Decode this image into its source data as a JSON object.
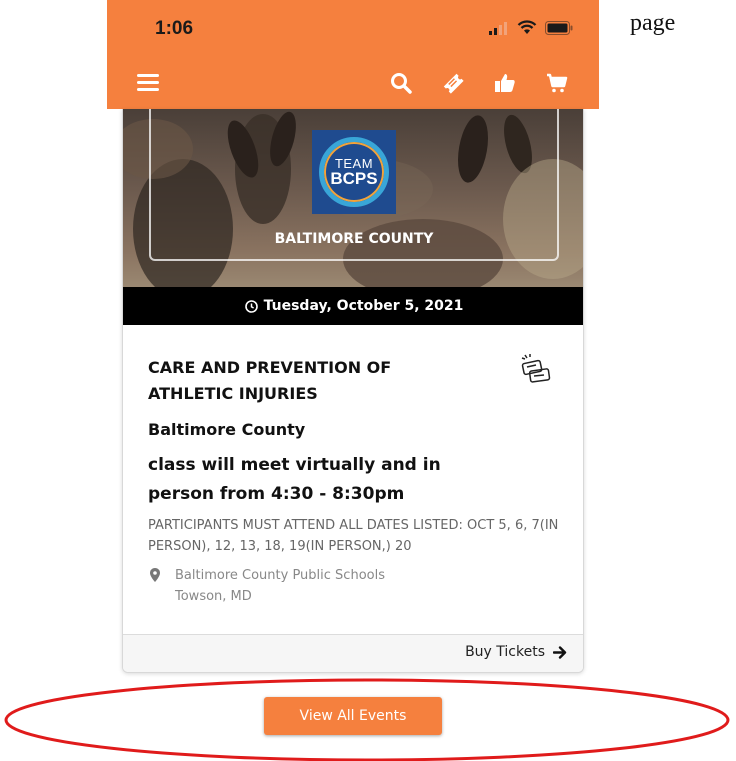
{
  "page_fragment": "page",
  "status_bar": {
    "time": "1:06"
  },
  "header": {
    "icons": [
      "menu-icon",
      "search-icon",
      "ticket-icon",
      "thumbs-up-icon",
      "cart-icon"
    ],
    "accent_color": "#f5803e"
  },
  "event": {
    "logo_line1": "TEAM",
    "logo_line2": "BCPS",
    "hero_title": "BALTIMORE COUNTY",
    "date": "Tuesday, October 5, 2021",
    "title": "CARE AND PREVENTION OF ATHLETIC INJURIES",
    "county": "Baltimore County",
    "description": "class will meet virtually and in person from 4:30 - 8:30pm",
    "note": "PARTICIPANTS MUST ATTEND ALL DATES LISTED: OCT 5, 6, 7(IN PERSON), 12, 13, 18, 19(IN PERSON,) 20",
    "venue": "Baltimore County Public Schools",
    "city": "Towson, MD",
    "buy_label": "Buy Tickets"
  },
  "view_all_label": "View All Events",
  "annotation_color": "#e01b1b"
}
